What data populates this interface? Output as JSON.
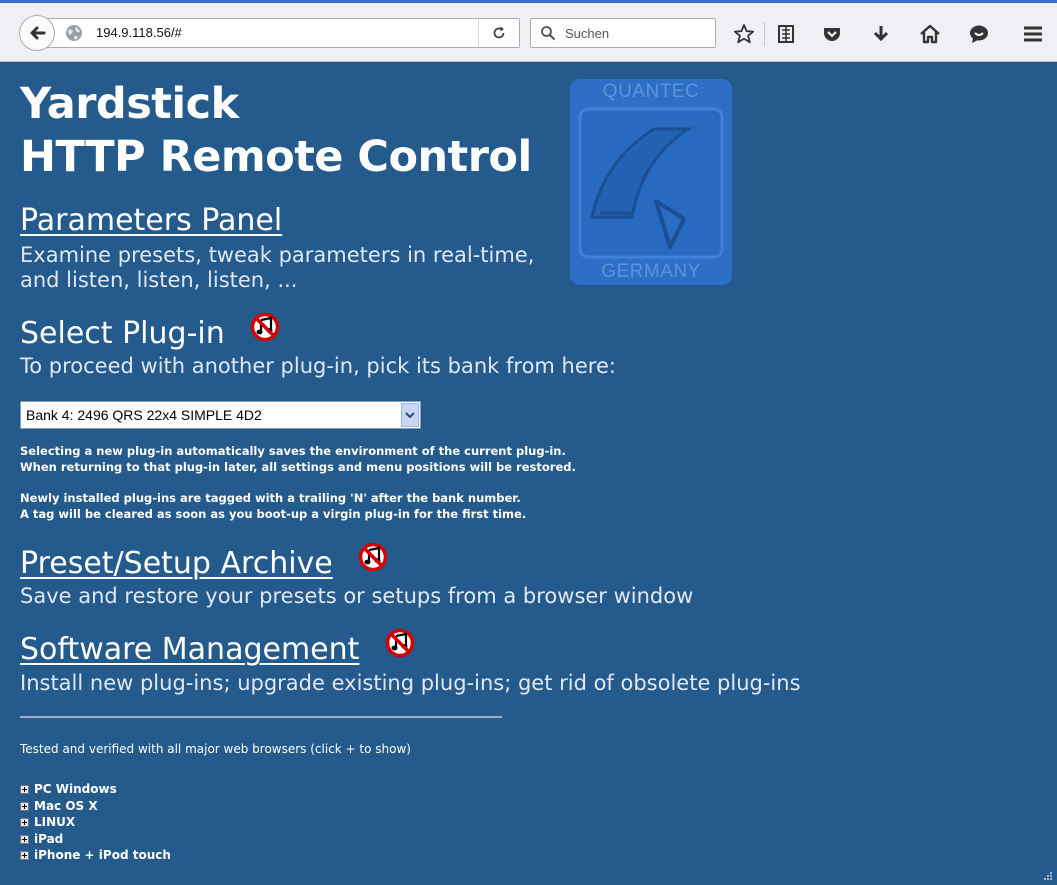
{
  "browser": {
    "url": "194.9.118.56/#",
    "search_placeholder": "Suchen"
  },
  "page": {
    "title_line1": "Yardstick",
    "title_line2": "HTTP Remote Control",
    "logo_top": "QUANTEC",
    "logo_bottom": "GERMANY",
    "parameters": {
      "heading": "Parameters Panel",
      "desc_line1": "Examine presets, tweak parameters in real-time,",
      "desc_line2": "and listen, listen, listen, ..."
    },
    "select_plugin": {
      "heading": "Select Plug-in",
      "desc": "To proceed with another plug-in, pick its bank from here:",
      "selected": "Bank 4: 2496 QRS 22x4 SIMPLE 4D2",
      "note1_line1": "Selecting a new plug-in automatically saves the environment of the current plug-in.",
      "note1_line2": "When returning to that plug-in later, all settings and menu positions will be restored.",
      "note2_line1": "Newly installed plug-ins are tagged with a trailing 'N' after the bank number.",
      "note2_line2": "A tag will be cleared as soon as you boot-up a virgin plug-in for the first time."
    },
    "archive": {
      "heading": "Preset/Setup Archive",
      "desc": "Save and restore your presets or setups from a browser window"
    },
    "software": {
      "heading": "Software Management",
      "desc": "Install new plug-ins; upgrade existing plug-ins; get rid of obsolete plug-ins"
    },
    "tested": "Tested and verified with all major web browsers (click + to show)",
    "platforms": [
      "PC Windows",
      "Mac OS X",
      "LINUX",
      "iPad",
      "iPhone + iPod touch"
    ]
  },
  "colors": {
    "page_background": "#245a8c",
    "logo_blue": "#2d6fc6"
  }
}
